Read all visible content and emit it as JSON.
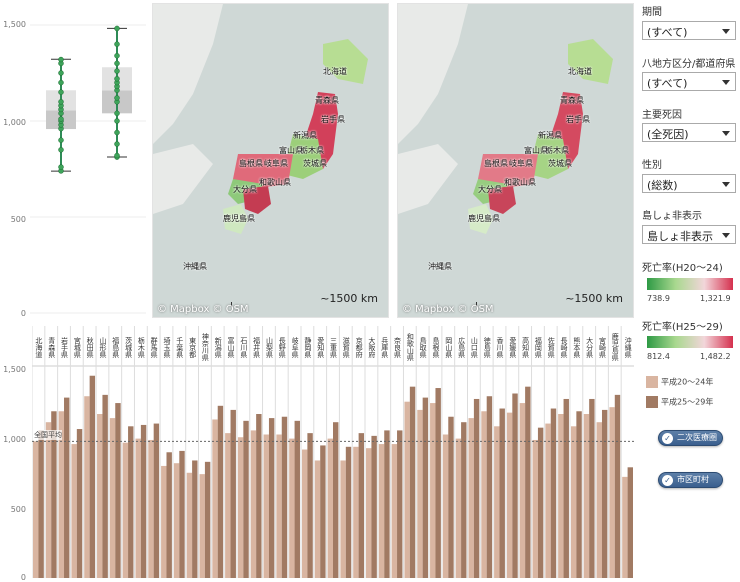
{
  "boxplot": {
    "yticks": [
      "1,500",
      "1,000",
      "500",
      "0"
    ],
    "periods": [
      {
        "name": "H20-24",
        "min": 738.9,
        "q1": 958,
        "median": 1055,
        "q3": 1160,
        "max": 1321.9,
        "dots": [
          740,
          760,
          850,
          900,
          960,
          980,
          1000,
          1010,
          1040,
          1060,
          1080,
          1100,
          1150,
          1200,
          1250,
          1300,
          1320
        ]
      },
      {
        "name": "H25-29",
        "min": 812.4,
        "q1": 1040,
        "median": 1160,
        "q3": 1280,
        "max": 1482.2,
        "dots": [
          812,
          820,
          880,
          940,
          1000,
          1040,
          1100,
          1120,
          1160,
          1180,
          1200,
          1220,
          1260,
          1300,
          1340,
          1400,
          1482
        ]
      }
    ]
  },
  "map": {
    "attribution": "© Mapbox  © OSM",
    "scale_label": "~1500 km",
    "labels": [
      "北海道",
      "青森県",
      "岩手県",
      "新潟県",
      "富山県",
      "栃木県",
      "島根県",
      "岐阜県",
      "茨城県",
      "大分県",
      "和歌山県",
      "鹿児島県",
      "沖縄県"
    ]
  },
  "filters": [
    {
      "title": "期間",
      "value": "(すべて)"
    },
    {
      "title": "八地方区分/都道府県",
      "value": "(すべて)"
    },
    {
      "title": "主要死因",
      "value": "(全死因)"
    },
    {
      "title": "性別",
      "value": "(総数)"
    },
    {
      "title": "島しょ非表示",
      "value": "島しょ非表示"
    }
  ],
  "legend1": {
    "title": "死亡率(H20～24)",
    "min": "738.9",
    "max": "1,321.9"
  },
  "legend2": {
    "title": "死亡率(H25～29)",
    "min": "812.4",
    "max": "1,482.2"
  },
  "swatches": [
    {
      "label": "平成20～24年",
      "color": "#d9b5a1"
    },
    {
      "label": "平成25～29年",
      "color": "#a17a63"
    }
  ],
  "buttons": {
    "secondary": "二次医療圏",
    "municipal": "市区町村"
  },
  "barchart": {
    "yticks": [
      "1,500",
      "1,000",
      "500",
      "0"
    ],
    "avg_label": "全国平均",
    "avg_value": 1000,
    "color1": "#d9b5a1",
    "color2": "#a17a63",
    "prefs": [
      "北海道",
      "青森県",
      "岩手県",
      "宮城県",
      "秋田県",
      "山形県",
      "福島県",
      "茨城県",
      "栃木県",
      "群馬県",
      "埼玉県",
      "千葉県",
      "東京都",
      "神奈川県",
      "新潟県",
      "富山県",
      "石川県",
      "福井県",
      "山梨県",
      "長野県",
      "岐阜県",
      "静岡県",
      "愛知県",
      "三重県",
      "滋賀県",
      "京都府",
      "大阪府",
      "兵庫県",
      "奈良県",
      "和歌山県",
      "鳥取県",
      "島根県",
      "岡山県",
      "広島県",
      "山口県",
      "徳島県",
      "香川県",
      "愛媛県",
      "高知県",
      "福岡県",
      "佐賀県",
      "長崎県",
      "熊本県",
      "大分県",
      "宮崎県",
      "鹿児島県",
      "沖縄県"
    ],
    "v1": [
      1000,
      1140,
      1220,
      980,
      1330,
      1200,
      1170,
      990,
      1020,
      1010,
      820,
      840,
      770,
      760,
      1160,
      1060,
      1030,
      1080,
      1050,
      1050,
      1020,
      940,
      860,
      1020,
      860,
      960,
      950,
      980,
      980,
      1290,
      1230,
      1280,
      1050,
      1020,
      1170,
      1220,
      1110,
      1210,
      1280,
      1010,
      1130,
      1200,
      1110,
      1200,
      1140,
      1250,
      740
    ],
    "v2": [
      1080,
      1220,
      1320,
      1090,
      1480,
      1340,
      1280,
      1110,
      1120,
      1130,
      920,
      930,
      860,
      850,
      1260,
      1230,
      1150,
      1200,
      1170,
      1180,
      1150,
      1060,
      970,
      1140,
      960,
      1060,
      1040,
      1080,
      1080,
      1400,
      1320,
      1390,
      1180,
      1140,
      1310,
      1330,
      1240,
      1350,
      1400,
      1100,
      1240,
      1310,
      1220,
      1310,
      1230,
      1340,
      810
    ]
  }
}
